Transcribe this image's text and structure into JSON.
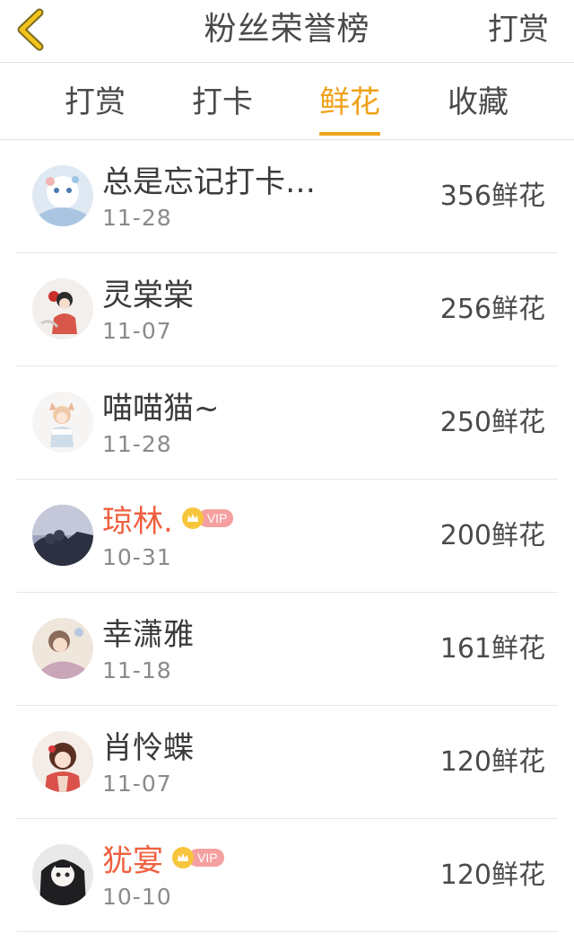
{
  "header": {
    "title": "粉丝荣誉榜",
    "action_label": "打赏"
  },
  "tabs": [
    {
      "label": "打赏",
      "active": false
    },
    {
      "label": "打卡",
      "active": false
    },
    {
      "label": "鲜花",
      "active": true
    },
    {
      "label": "收藏",
      "active": false
    }
  ],
  "colors": {
    "accent": "#f0a21a",
    "vip_name": "#f05f3f"
  },
  "list": [
    {
      "name": "总是忘记打卡…",
      "date": "11-28",
      "amount": "356鲜花",
      "vip": false
    },
    {
      "name": "灵棠棠",
      "date": "11-07",
      "amount": "256鲜花",
      "vip": false
    },
    {
      "name": "喵喵猫~",
      "date": "11-28",
      "amount": "250鲜花",
      "vip": false
    },
    {
      "name": "琼林.",
      "date": "10-31",
      "amount": "200鲜花",
      "vip": true,
      "vip_label": "VIP"
    },
    {
      "name": "幸潇雅",
      "date": "11-18",
      "amount": "161鲜花",
      "vip": false
    },
    {
      "name": "肖怜蝶",
      "date": "11-07",
      "amount": "120鲜花",
      "vip": false
    },
    {
      "name": "犹宴",
      "date": "10-10",
      "amount": "120鲜花",
      "vip": true,
      "vip_label": "VIP"
    }
  ]
}
